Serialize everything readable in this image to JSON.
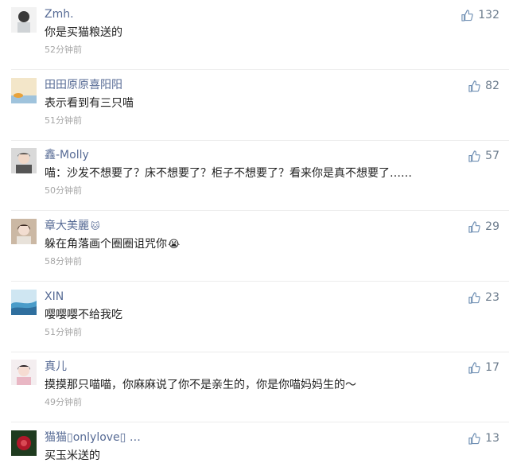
{
  "comments": [
    {
      "username": "Zmh.",
      "content": "你是买猫粮送的",
      "time": "52分钟前",
      "likes": "132",
      "avatar_icon": "avatar-user-icon"
    },
    {
      "username": "田田原原喜阳阳",
      "content": "表示看到有三只喵",
      "time": "51分钟前",
      "likes": "82",
      "avatar_icon": "avatar-user-icon"
    },
    {
      "username": "鑫-Molly",
      "content": "喵：沙发不想要了？床不想要了？柜子不想要了？看来你是真不想要了……",
      "time": "50分钟前",
      "likes": "57",
      "avatar_icon": "avatar-user-icon"
    },
    {
      "username": "章大美麗",
      "username_emoji": "🐱",
      "content": "躲在角落画个圈圈诅咒你",
      "content_emoji": "😭",
      "time": "58分钟前",
      "likes": "29",
      "avatar_icon": "avatar-user-icon"
    },
    {
      "username": "XIN",
      "content": "嘤嘤嘤不给我吃",
      "time": "51分钟前",
      "likes": "23",
      "avatar_icon": "avatar-user-icon"
    },
    {
      "username": "真儿",
      "content": "摸摸那只喵喵，你麻麻说了你不是亲生的，你是你喵妈妈生的～",
      "time": "49分钟前",
      "likes": "17",
      "avatar_icon": "avatar-user-icon"
    },
    {
      "username": "猫猫▯onlylove▯ …",
      "content": "买玉米送的",
      "time": "",
      "likes": "13",
      "avatar_icon": "avatar-user-icon"
    }
  ],
  "like_icon": "thumbs-up-icon",
  "colors": {
    "username": "#576b95",
    "content": "#222222",
    "time": "#a6a6a6",
    "like_icon": "#6f8fb3",
    "divider": "#ececec"
  }
}
